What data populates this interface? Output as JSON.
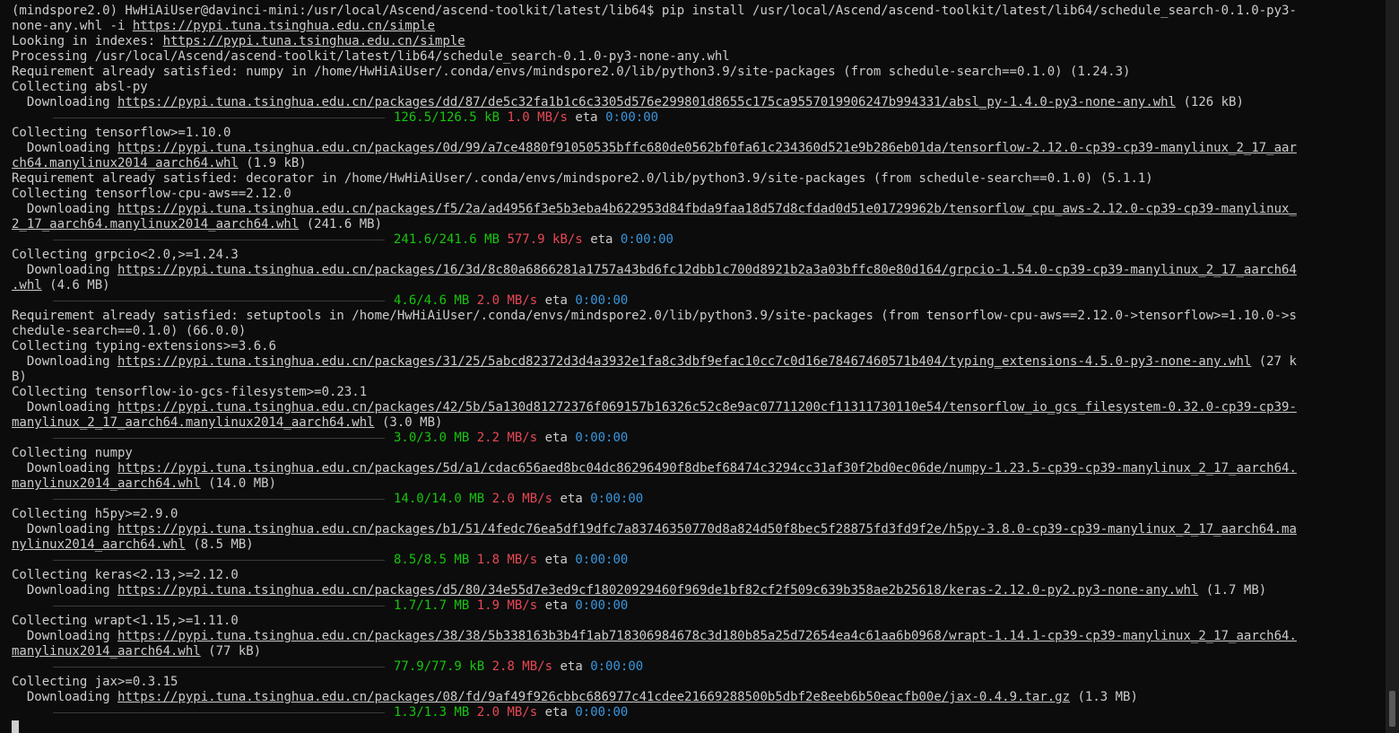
{
  "lines": [
    "(mindspore2.0) HwHiAiUser@davinci-mini:/usr/local/Ascend/ascend-toolkit/latest/lib64$ pip install /usr/local/Ascend/ascend-toolkit/latest/lib64/schedule_search-0.1.0-py3-",
    "none-any.whl -i ",
    "Looking in indexes: ",
    "Processing /usr/local/Ascend/ascend-toolkit/latest/lib64/schedule_search-0.1.0-py3-none-any.whl",
    "Requirement already satisfied: numpy in /home/HwHiAiUser/.conda/envs/mindspore2.0/lib/python3.9/site-packages (from schedule-search==0.1.0) (1.24.3)",
    "Collecting absl-py",
    "  Downloading ",
    " (126 kB)",
    "Collecting tensorflow>=1.10.0",
    "  Downloading ",
    " (1.9 kB)",
    "Requirement already satisfied: decorator in /home/HwHiAiUser/.conda/envs/mindspore2.0/lib/python3.9/site-packages (from schedule-search==0.1.0) (5.1.1)",
    "Collecting tensorflow-cpu-aws==2.12.0",
    "  Downloading ",
    " (241.6 MB)",
    "Collecting grpcio<2.0,>=1.24.3",
    "  Downloading ",
    " (4.6 MB)",
    "Requirement already satisfied: setuptools in /home/HwHiAiUser/.conda/envs/mindspore2.0/lib/python3.9/site-packages (from tensorflow-cpu-aws==2.12.0->tensorflow>=1.10.0->s",
    "chedule-search==0.1.0) (66.0.0)",
    "Collecting typing-extensions>=3.6.6",
    "  Downloading ",
    " (27 k",
    "B)",
    "Collecting tensorflow-io-gcs-filesystem>=0.23.1",
    "  Downloading ",
    " (3.0 MB)",
    "Collecting numpy",
    "  Downloading ",
    " (14.0 MB)",
    "Collecting h5py>=2.9.0",
    "  Downloading ",
    " (8.5 MB)",
    "Collecting keras<2.13,>=2.12.0",
    "  Downloading ",
    " (1.7 MB)",
    "Collecting wrapt<1.15,>=1.11.0",
    "  Downloading ",
    " (77 kB)",
    "Collecting jax>=0.3.15",
    "  Downloading ",
    " (1.3 MB)"
  ],
  "links": {
    "index_url": "https://pypi.tuna.tsinghua.edu.cn/simple",
    "absl_a": "https://pypi.tuna.tsinghua.edu.cn/packages/dd/87/de5c32fa1b1c6c3305d576e299801d8655c175ca9557019906247b994331/absl_py-1.4.0-py3-none-any.whl",
    "tf_a": "https://pypi.tuna.tsinghua.edu.cn/packages/0d/99/a7ce4880f91050535bffc680de0562bf0fa61c234360d521e9b286eb01da/tensorflow-2.12.0-cp39-cp39-manylinux_2_17_aar",
    "tf_b": "ch64.manylinux2014_aarch64.whl",
    "tfcpu_a": "https://pypi.tuna.tsinghua.edu.cn/packages/f5/2a/ad4956f3e5b3eba4b622953d84fbda9faa18d57d8cfdad0d51e01729962b/tensorflow_cpu_aws-2.12.0-cp39-cp39-manylinux_",
    "tfcpu_b": "2_17_aarch64.manylinux2014_aarch64.whl",
    "grpc_a": "https://pypi.tuna.tsinghua.edu.cn/packages/16/3d/8c80a6866281a1757a43bd6fc12dbb1c700d8921b2a3a03bffc80e80d164/grpcio-1.54.0-cp39-cp39-manylinux_2_17_aarch64",
    "grpc_b": ".whl",
    "typing_a": "https://pypi.tuna.tsinghua.edu.cn/packages/31/25/5abcd82372d3d4a3932e1fa8c3dbf9efac10cc7c0d16e78467460571b404/typing_extensions-4.5.0-py3-none-any.whl",
    "tfio_a": "https://pypi.tuna.tsinghua.edu.cn/packages/42/5b/5a130d81272376f069157b16326c52c8e9ac07711200cf11311730110e54/tensorflow_io_gcs_filesystem-0.32.0-cp39-cp39-",
    "tfio_b": "manylinux_2_17_aarch64.manylinux2014_aarch64.whl",
    "numpy_a": "https://pypi.tuna.tsinghua.edu.cn/packages/5d/a1/cdac656aed8bc04dc86296490f8dbef68474c3294cc31af30f2bd0ec06de/numpy-1.23.5-cp39-cp39-manylinux_2_17_aarch64.",
    "numpy_b": "manylinux2014_aarch64.whl",
    "h5py_a": "https://pypi.tuna.tsinghua.edu.cn/packages/b1/51/4fedc76ea5df19dfc7a83746350770d8a824d50f8bec5f28875fd3fd9f2e/h5py-3.8.0-cp39-cp39-manylinux_2_17_aarch64.ma",
    "h5py_b": "nylinux2014_aarch64.whl",
    "keras_a": "https://pypi.tuna.tsinghua.edu.cn/packages/d5/80/34e55d7e3ed9cf18020929460f969de1bf82cf2f509c639b358ae2b25618/keras-2.12.0-py2.py3-none-any.whl",
    "wrapt_a": "https://pypi.tuna.tsinghua.edu.cn/packages/38/38/5b338163b3b4f1ab718306984678c3d180b85a25d72654ea4c61aa6b0968/wrapt-1.14.1-cp39-cp39-manylinux_2_17_aarch64.",
    "wrapt_b": "manylinux2014_aarch64.whl",
    "jax_a": "https://pypi.tuna.tsinghua.edu.cn/packages/08/fd/9af49f926cbbc686977c41cdee21669288500b5dbf2e8eeb6b50eacfb00e/jax-0.4.9.tar.gz"
  },
  "progress": {
    "absl": {
      "size": "126.5/126.5 kB",
      "rate": "1.0 MB/s",
      "eta_label": "eta",
      "eta": "0:00:00",
      "fraction": 1.0
    },
    "tfcpu": {
      "size": "241.6/241.6 MB",
      "rate": "577.9 kB/s",
      "eta_label": "eta",
      "eta": "0:00:00",
      "fraction": 1.0
    },
    "grpc": {
      "size": "4.6/4.6 MB",
      "rate": "2.0 MB/s",
      "eta_label": "eta",
      "eta": "0:00:00",
      "fraction": 1.0
    },
    "tfio": {
      "size": "3.0/3.0 MB",
      "rate": "2.2 MB/s",
      "eta_label": "eta",
      "eta": "0:00:00",
      "fraction": 1.0
    },
    "numpy": {
      "size": "14.0/14.0 MB",
      "rate": "2.0 MB/s",
      "eta_label": "eta",
      "eta": "0:00:00",
      "fraction": 1.0
    },
    "h5py": {
      "size": "8.5/8.5 MB",
      "rate": "1.8 MB/s",
      "eta_label": "eta",
      "eta": "0:00:00",
      "fraction": 1.0
    },
    "keras": {
      "size": "1.7/1.7 MB",
      "rate": "1.9 MB/s",
      "eta_label": "eta",
      "eta": "0:00:00",
      "fraction": 1.0
    },
    "wrapt": {
      "size": "77.9/77.9 kB",
      "rate": "2.8 MB/s",
      "eta_label": "eta",
      "eta": "0:00:00",
      "fraction": 1.0
    },
    "jax": {
      "size": "1.3/1.3 MB",
      "rate": "2.0 MB/s",
      "eta_label": "eta",
      "eta": "0:00:00",
      "fraction": 1.0
    }
  },
  "colors": {
    "background": "#0c0c0c",
    "text": "#cccccc",
    "progress_size": "#16c60c",
    "progress_rate": "#e74856",
    "progress_eta": "#3a96dd"
  }
}
